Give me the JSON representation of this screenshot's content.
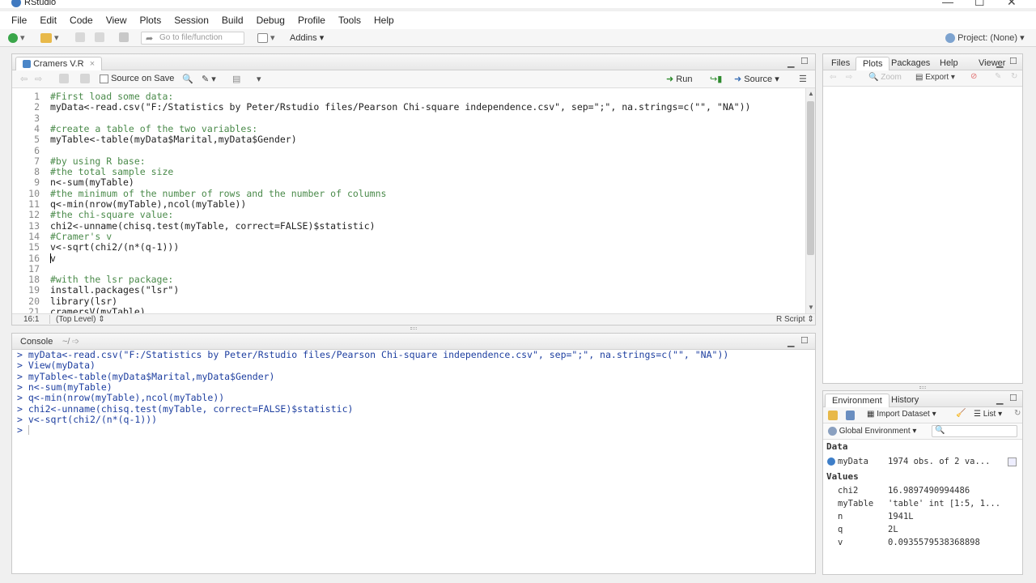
{
  "window": {
    "title": "RStudio",
    "controls": [
      "—",
      "☐",
      "✕"
    ]
  },
  "menu": [
    "File",
    "Edit",
    "Code",
    "View",
    "Plots",
    "Session",
    "Build",
    "Debug",
    "Profile",
    "Tools",
    "Help"
  ],
  "toolbar": {
    "goto_placeholder": "Go to file/function",
    "addins": "Addins",
    "project": "Project: (None)"
  },
  "editor": {
    "tab_name": "Cramers V.R",
    "source_on_save": "Source on Save",
    "run_label": "Run",
    "source_label": "Source",
    "status_position": "16:1",
    "status_scope": "(Top Level)",
    "status_type": "R Script",
    "lines": [
      {
        "n": "1",
        "kind": "comment",
        "text": "#First load some data:"
      },
      {
        "n": "2",
        "kind": "code",
        "text": "myData<-read.csv(\"F:/Statistics by Peter/Rstudio files/Pearson Chi-square independence.csv\", sep=\";\", na.strings=c(\"\", \"NA\"))"
      },
      {
        "n": "3",
        "kind": "code",
        "text": ""
      },
      {
        "n": "4",
        "kind": "comment",
        "text": "#create a table of the two variables:"
      },
      {
        "n": "5",
        "kind": "code",
        "text": "myTable<-table(myData$Marital,myData$Gender)"
      },
      {
        "n": "6",
        "kind": "code",
        "text": ""
      },
      {
        "n": "7",
        "kind": "comment",
        "text": "#by using R base:"
      },
      {
        "n": "8",
        "kind": "comment",
        "text": "#the total sample size"
      },
      {
        "n": "9",
        "kind": "code",
        "text": "n<-sum(myTable)"
      },
      {
        "n": "10",
        "kind": "comment",
        "text": "#the minimum of the number of rows and the number of columns"
      },
      {
        "n": "11",
        "kind": "code",
        "text": "q<-min(nrow(myTable),ncol(myTable))"
      },
      {
        "n": "12",
        "kind": "comment",
        "text": "#the chi-square value:"
      },
      {
        "n": "13",
        "kind": "code",
        "text": "chi2<-unname(chisq.test(myTable, correct=FALSE)$statistic)"
      },
      {
        "n": "14",
        "kind": "comment",
        "text": "#Cramer's v"
      },
      {
        "n": "15",
        "kind": "code",
        "text": "v<-sqrt(chi2/(n*(q-1)))"
      },
      {
        "n": "16",
        "kind": "code",
        "text": "v"
      },
      {
        "n": "17",
        "kind": "code",
        "text": ""
      },
      {
        "n": "18",
        "kind": "comment",
        "text": "#with the lsr package:"
      },
      {
        "n": "19",
        "kind": "code",
        "text": "install.packages(\"lsr\")"
      },
      {
        "n": "20",
        "kind": "code",
        "text": "library(lsr)"
      },
      {
        "n": "21",
        "kind": "code",
        "text": "cramersV(myTable)"
      }
    ]
  },
  "console": {
    "title": "Console",
    "path": "~/",
    "lines": [
      "> myData<-read.csv(\"F:/Statistics by Peter/Rstudio files/Pearson Chi-square independence.csv\", sep=\";\", na.strings=c(\"\", \"NA\"))",
      "> View(myData)",
      "> myTable<-table(myData$Marital,myData$Gender)",
      "> n<-sum(myTable)",
      "> q<-min(nrow(myTable),ncol(myTable))",
      "> chi2<-unname(chisq.test(myTable, correct=FALSE)$statistic)",
      "> v<-sqrt(chi2/(n*(q-1)))",
      "> "
    ]
  },
  "files_pane": {
    "tabs": [
      "Files",
      "Plots",
      "Packages",
      "Help",
      "Viewer"
    ],
    "zoom": "Zoom",
    "export": "Export"
  },
  "env_pane": {
    "tabs": [
      "Environment",
      "History"
    ],
    "import_dataset": "Import Dataset",
    "list": "List",
    "scope": "Global Environment",
    "data_header": "Data",
    "values_header": "Values",
    "data_rows": [
      {
        "name": "myData",
        "value": "1974 obs. of 2 va..."
      }
    ],
    "value_rows": [
      {
        "name": "chi2",
        "value": "16.9897490994486"
      },
      {
        "name": "myTable",
        "value": "'table' int [1:5, 1..."
      },
      {
        "name": "n",
        "value": "1941L"
      },
      {
        "name": "q",
        "value": "2L"
      },
      {
        "name": "v",
        "value": "0.0935579538368898"
      }
    ]
  }
}
